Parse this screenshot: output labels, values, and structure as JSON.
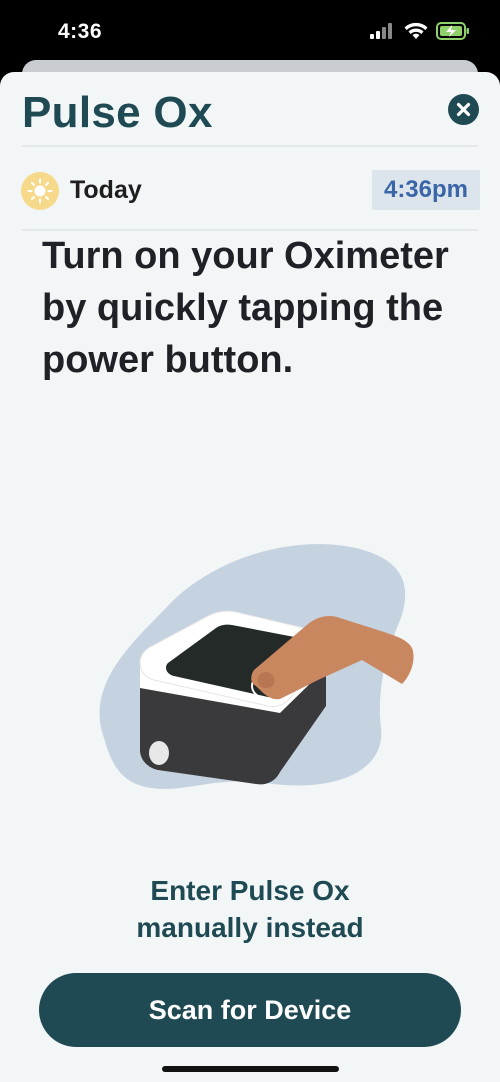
{
  "status_bar": {
    "time": "4:36",
    "icons": [
      "signal-icon",
      "wifi-icon",
      "battery-charging-icon"
    ]
  },
  "header": {
    "title": "Pulse Ox",
    "close_icon": "close-icon"
  },
  "day_row": {
    "icon": "sun-icon",
    "label": "Today",
    "time": "4:36pm"
  },
  "instruction": "Turn on your Oximeter by quickly tapping the power button.",
  "illustration": {
    "icon": "oximeter-finger-tap-illustration"
  },
  "actions": {
    "manual_line1": "Enter Pulse Ox",
    "manual_line2": "manually instead",
    "scan_label": "Scan for Device"
  },
  "colors": {
    "primary": "#1f4a54",
    "background": "#f3f6f7",
    "time_badge_bg": "#dde5ec",
    "time_badge_text": "#3a66a8",
    "sun": "#f6d98a"
  }
}
